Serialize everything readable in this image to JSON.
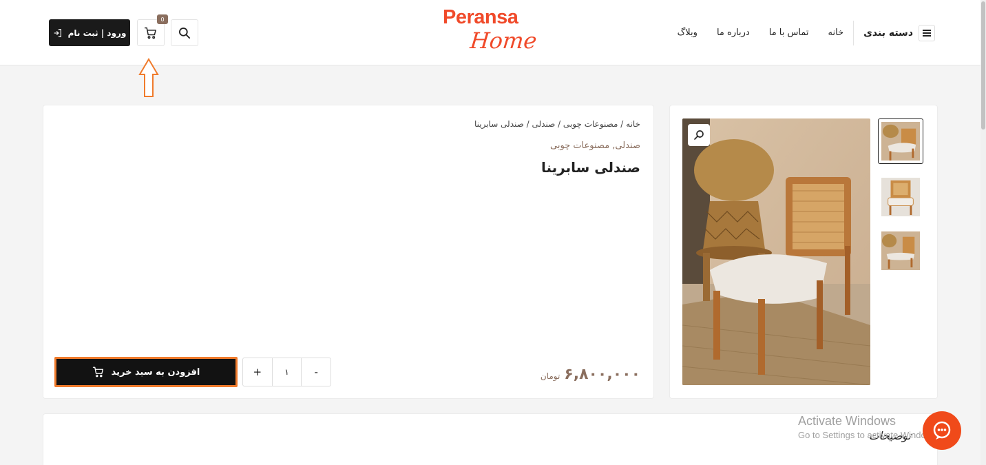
{
  "header": {
    "login_label": "ورود | ثبت نام",
    "cart_count": "0",
    "logo_line1": "Peransa",
    "logo_line2": "Home",
    "nav": {
      "categories_label": "دسته بندی",
      "items": [
        "خانه",
        "تماس با ما",
        "درباره ما",
        "وبلاگ"
      ]
    }
  },
  "product": {
    "breadcrumb": "خانه / مصنوعات چوبی / صندلی / صندلی سابرینا",
    "categories": "صندلی, مصنوعات چوبی",
    "title": "صندلی سابرینا",
    "price": "۶,۸۰۰,۰۰۰",
    "currency": "تومان",
    "quantity": "۱",
    "qty_minus": "-",
    "qty_plus": "+",
    "add_to_cart_label": "افزودن به سبد خرید"
  },
  "description": {
    "tab_title": "توضیحات"
  },
  "watermark": {
    "line1": "Activate Windows",
    "line2": "Go to Settings to activate Windows."
  },
  "colors": {
    "brand": "#f04a2a",
    "accent_brown": "#8a6e5e",
    "highlight_orange": "#f07b2c",
    "button_dark": "#121212"
  }
}
